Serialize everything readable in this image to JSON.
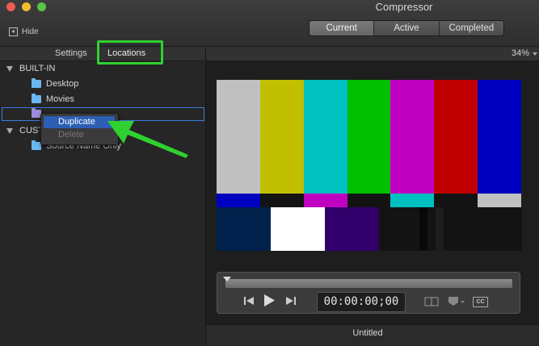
{
  "window": {
    "title": "Compressor",
    "hide_label": "Hide",
    "view_tabs": [
      "Current",
      "Active",
      "Completed"
    ]
  },
  "sidebar": {
    "tabs": [
      "Settings",
      "Locations"
    ],
    "sections": [
      {
        "label": "BUILT-IN",
        "items": [
          "Desktop",
          "Movies"
        ]
      },
      {
        "label": "CUST",
        "items": [
          "Source Name Only"
        ]
      }
    ]
  },
  "context_menu": {
    "items": [
      {
        "label": "Duplicate",
        "enabled": true,
        "highlighted": true
      },
      {
        "label": "Delete",
        "enabled": false
      }
    ]
  },
  "viewer": {
    "zoom": "34%",
    "timecode": "00:00:00;00",
    "title": "Untitled",
    "cc_label": "CC",
    "color_bars": {
      "top": [
        "#c0c0c0",
        "#c0c000",
        "#00c0c0",
        "#00c000",
        "#c000c0",
        "#c00000",
        "#0000c0"
      ],
      "middle": [
        "#0000c0",
        "#131313",
        "#c000c0",
        "#131313",
        "#00c0c0",
        "#131313",
        "#c0c0c0"
      ],
      "bottom": [
        "#00214c",
        "#ffffff",
        "#32006a",
        "#131313",
        "#090909",
        "#131313",
        "#1d1d1d",
        "#131313"
      ]
    }
  },
  "annotations": {
    "highlight_color": "#2fd12f"
  }
}
